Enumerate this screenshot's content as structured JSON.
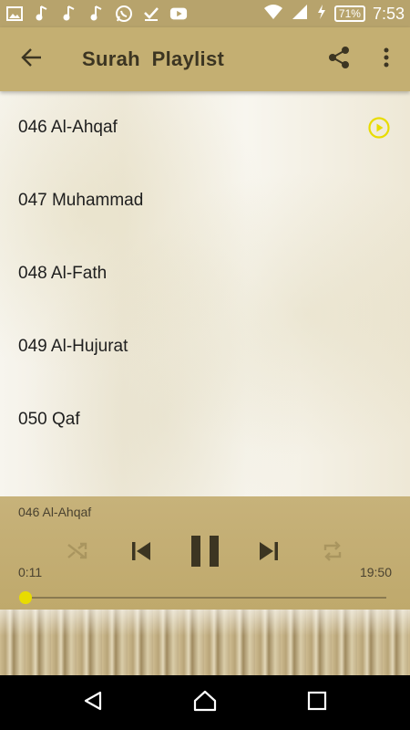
{
  "status_bar": {
    "icons": [
      "gallery-icon",
      "music-note-icon",
      "music-note-icon",
      "music-note-icon",
      "whatsapp-icon",
      "download-done-icon",
      "youtube-icon"
    ],
    "battery": "71%",
    "time": "7:53"
  },
  "app_bar": {
    "title": "Surah  Playlist",
    "actions": [
      "share-icon",
      "more-vert-icon"
    ]
  },
  "playlist": {
    "items": [
      {
        "label": "046 Al-Ahqaf",
        "playing": true
      },
      {
        "label": "047 Muhammad",
        "playing": false
      },
      {
        "label": "048 Al-Fath",
        "playing": false
      },
      {
        "label": "049 Al-Hujurat",
        "playing": false
      },
      {
        "label": "050 Qaf",
        "playing": false
      }
    ]
  },
  "player": {
    "now_playing": "046 Al-Ahqaf",
    "current_time": "0:11",
    "total_time": "19:50",
    "progress": 0.01
  },
  "colors": {
    "accent": "#e8dc00",
    "bar": "#c4af72",
    "player": "#bfa96c"
  }
}
